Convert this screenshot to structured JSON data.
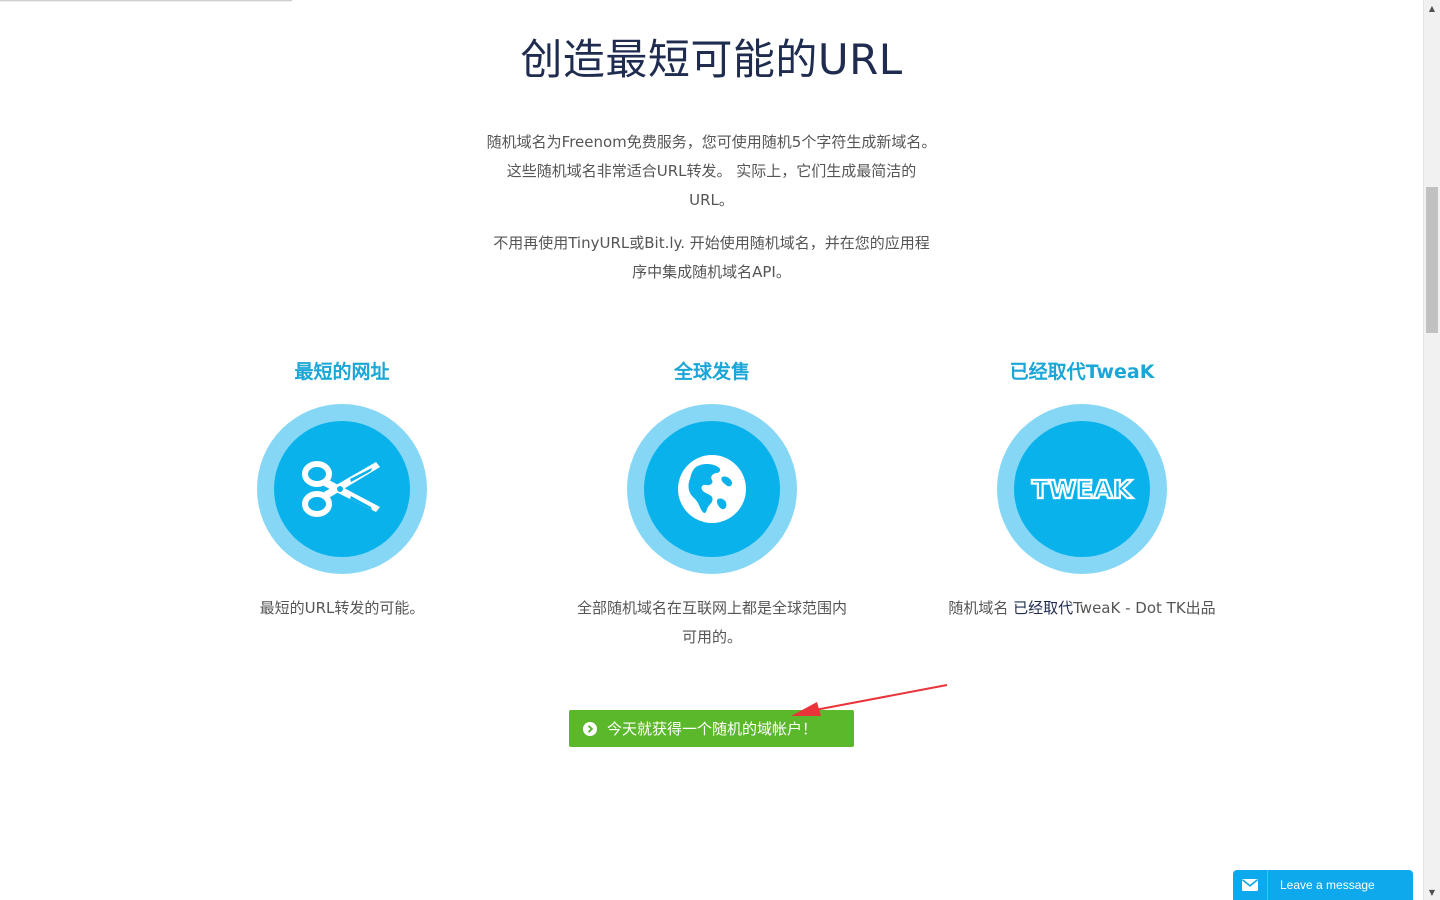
{
  "hero": {
    "title": "创造最短可能的URL"
  },
  "intro": {
    "paragraph_1": "随机域名为Freenom免费服务，您可使用随机5个字符生成新域名。 这些随机域名非常适合URL转发。 实际上，它们生成最简洁的URL。",
    "paragraph_2": "不用再使用TinyURL或Bit.ly. 开始使用随机域名，并在您的应用程序中集成随机域名API。"
  },
  "features": [
    {
      "title": "最短的网址",
      "icon": "scissors-icon",
      "description": "最短的URL转发的可能。"
    },
    {
      "title": "全球发售",
      "icon": "globe-icon",
      "description": "全部随机域名在互联网上都是全球范围内可用的。"
    },
    {
      "title": "已经取代TweaK",
      "icon": "tweak-logo-icon",
      "logo_text": "TWEAK",
      "description_prefix": "随机域名 ",
      "description_strong": "已经取代",
      "description_suffix": "TweaK - Dot TK出品"
    }
  ],
  "cta": {
    "label": "今天就获得一个随机的域帐户！",
    "icon": "chevron-circle-right-icon"
  },
  "chat": {
    "label": "Leave a message",
    "icon": "envelope-icon"
  },
  "colors": {
    "title": "#1f2c4f",
    "accent": "#1aa6d6",
    "circle_outer": "#85d7f5",
    "circle_inner": "#0ab2eb",
    "cta": "#5cb82b",
    "chat": "#0ea9ec",
    "annotation": "#e8343a"
  }
}
